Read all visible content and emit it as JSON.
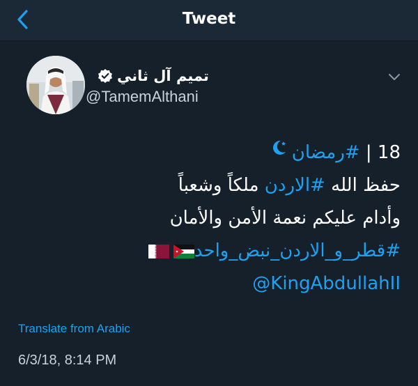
{
  "header": {
    "title": "Tweet",
    "back_icon": "chevron-left-icon"
  },
  "author": {
    "display_name": "تميم آل ثاني",
    "handle": "@TamemAlthani",
    "verified_icon": "verified-badge-icon",
    "more_icon": "chevron-down-icon"
  },
  "tweet": {
    "line1_number": "18 |",
    "line1_hashtag": "#رمضان",
    "line1_emoji_icon": "crescent-moon-icon",
    "line2_prefix": "حفظ الله",
    "line2_hashtag": "#الاردن",
    "line2_suffix": "ملكاً وشعباً",
    "line3": "وأدام عليكم نعمة الأمن والأمان",
    "line4_hashtag": "#قطر_و_الاردن_نبض_واحد",
    "line4_flags": [
      "jordan-flag-icon",
      "qatar-flag-icon"
    ],
    "line5_mention": "@KingAbdullahII"
  },
  "translate_label": "Translate from Arabic",
  "timestamp": "6/3/18, 8:14 PM",
  "colors": {
    "background": "#15202b",
    "topbar": "#1b2836",
    "accent": "#1da1f2",
    "muted_text": "#c9d2da"
  }
}
